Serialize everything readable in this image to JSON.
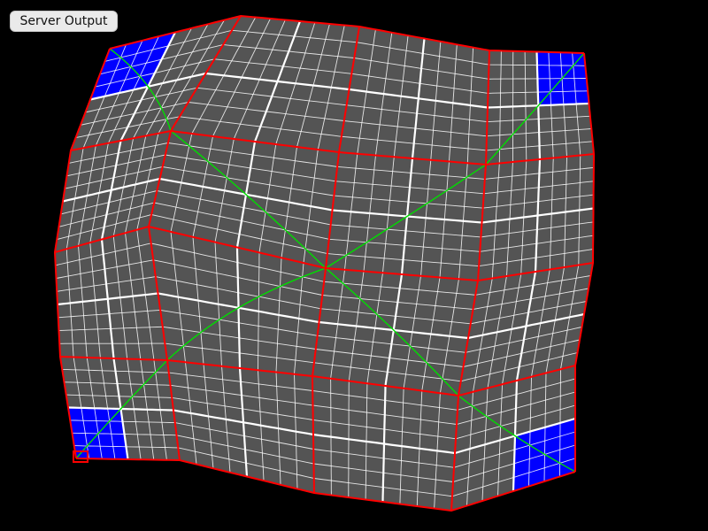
{
  "toolbar": {
    "server_output_label": "Server Output"
  },
  "view": {
    "background_color": "#000000",
    "panel_color": "#545454",
    "fine_grid_color": "#ffffff",
    "coarse_grid_color": "#ff0000",
    "diagonal_color": "#00dd00",
    "corner_patch_color": "#0000ff"
  }
}
